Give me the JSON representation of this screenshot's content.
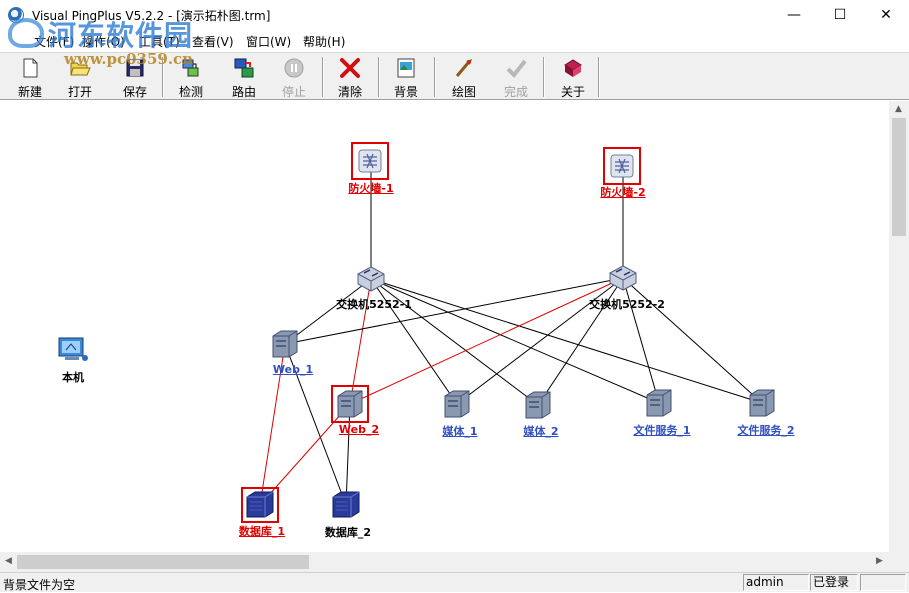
{
  "window": {
    "title": "Visual PingPlus V5.2.2 - [演示拓朴图.trm]",
    "minimize": "—",
    "maximize": "☐",
    "close": "✕"
  },
  "watermark": {
    "name": "河东软件园",
    "url": "www.pc0359.cn"
  },
  "menu": [
    {
      "label": "文件(F)"
    },
    {
      "label": "操作(O)"
    },
    {
      "label": "工具(T)"
    },
    {
      "label": "查看(V)"
    },
    {
      "label": "窗口(W)"
    },
    {
      "label": "帮助(H)"
    }
  ],
  "mdi_controls": {
    "minimize": "_",
    "restore": "❐",
    "close": "×"
  },
  "toolbar": [
    {
      "label": "新建",
      "icon": "new-file-icon",
      "enabled": true
    },
    {
      "label": "打开",
      "icon": "open-folder-icon",
      "enabled": true
    },
    {
      "label": "保存",
      "icon": "save-icon",
      "enabled": true
    },
    {
      "label": "检测",
      "icon": "detect-icon",
      "enabled": true
    },
    {
      "label": "路由",
      "icon": "route-icon",
      "enabled": true
    },
    {
      "label": "停止",
      "icon": "stop-icon",
      "enabled": false
    },
    {
      "label": "清除",
      "icon": "clear-icon",
      "enabled": true
    },
    {
      "label": "背景",
      "icon": "background-icon",
      "enabled": true
    },
    {
      "label": "绘图",
      "icon": "draw-icon",
      "enabled": true
    },
    {
      "label": "完成",
      "icon": "finish-icon",
      "enabled": false
    },
    {
      "label": "关于",
      "icon": "about-icon",
      "enabled": true
    }
  ],
  "topology": {
    "nodes": [
      {
        "id": "fw1",
        "label": "防火墙-1",
        "type": "firewall",
        "status": "alarm"
      },
      {
        "id": "fw2",
        "label": "防火墙-2",
        "type": "firewall",
        "status": "alarm"
      },
      {
        "id": "sw1",
        "label": "交换机5252-1",
        "type": "switch",
        "status": "normal"
      },
      {
        "id": "sw2",
        "label": "交换机5252-2",
        "type": "switch",
        "status": "normal"
      },
      {
        "id": "local",
        "label": "本机",
        "type": "computer",
        "status": "normal"
      },
      {
        "id": "web1",
        "label": "Web_1",
        "type": "server",
        "status": "ok"
      },
      {
        "id": "web2",
        "label": "Web_2",
        "type": "server",
        "status": "alarm"
      },
      {
        "id": "media1",
        "label": "媒体_1",
        "type": "server",
        "status": "ok"
      },
      {
        "id": "media2",
        "label": "媒体_2",
        "type": "server",
        "status": "ok"
      },
      {
        "id": "fs1",
        "label": "文件服务_1",
        "type": "server",
        "status": "ok"
      },
      {
        "id": "fs2",
        "label": "文件服务_2",
        "type": "server",
        "status": "ok"
      },
      {
        "id": "db1",
        "label": "数据库_1",
        "type": "database",
        "status": "alarm"
      },
      {
        "id": "db2",
        "label": "数据库_2",
        "type": "database",
        "status": "normal"
      }
    ],
    "links": [
      {
        "from": "fw1",
        "to": "sw1",
        "status": "normal"
      },
      {
        "from": "fw2",
        "to": "sw2",
        "status": "normal"
      },
      {
        "from": "sw1",
        "to": "web1",
        "status": "normal"
      },
      {
        "from": "sw1",
        "to": "web2",
        "status": "alarm"
      },
      {
        "from": "sw1",
        "to": "media1",
        "status": "normal"
      },
      {
        "from": "sw1",
        "to": "media2",
        "status": "normal"
      },
      {
        "from": "sw1",
        "to": "fs1",
        "status": "normal"
      },
      {
        "from": "sw1",
        "to": "fs2",
        "status": "normal"
      },
      {
        "from": "sw2",
        "to": "web1",
        "status": "normal"
      },
      {
        "from": "sw2",
        "to": "web2",
        "status": "alarm"
      },
      {
        "from": "sw2",
        "to": "media1",
        "status": "normal"
      },
      {
        "from": "sw2",
        "to": "media2",
        "status": "normal"
      },
      {
        "from": "sw2",
        "to": "fs1",
        "status": "normal"
      },
      {
        "from": "sw2",
        "to": "fs2",
        "status": "normal"
      },
      {
        "from": "web1",
        "to": "db1",
        "status": "alarm"
      },
      {
        "from": "web1",
        "to": "db2",
        "status": "normal"
      },
      {
        "from": "web2",
        "to": "db1",
        "status": "alarm"
      },
      {
        "from": "web2",
        "to": "db2",
        "status": "normal"
      }
    ]
  },
  "status": {
    "message": "背景文件为空",
    "user": "admin",
    "login_state": "已登录"
  },
  "colors": {
    "alarm": "#e00000",
    "ok_label": "#3050c0",
    "normal_line": "#000000"
  }
}
